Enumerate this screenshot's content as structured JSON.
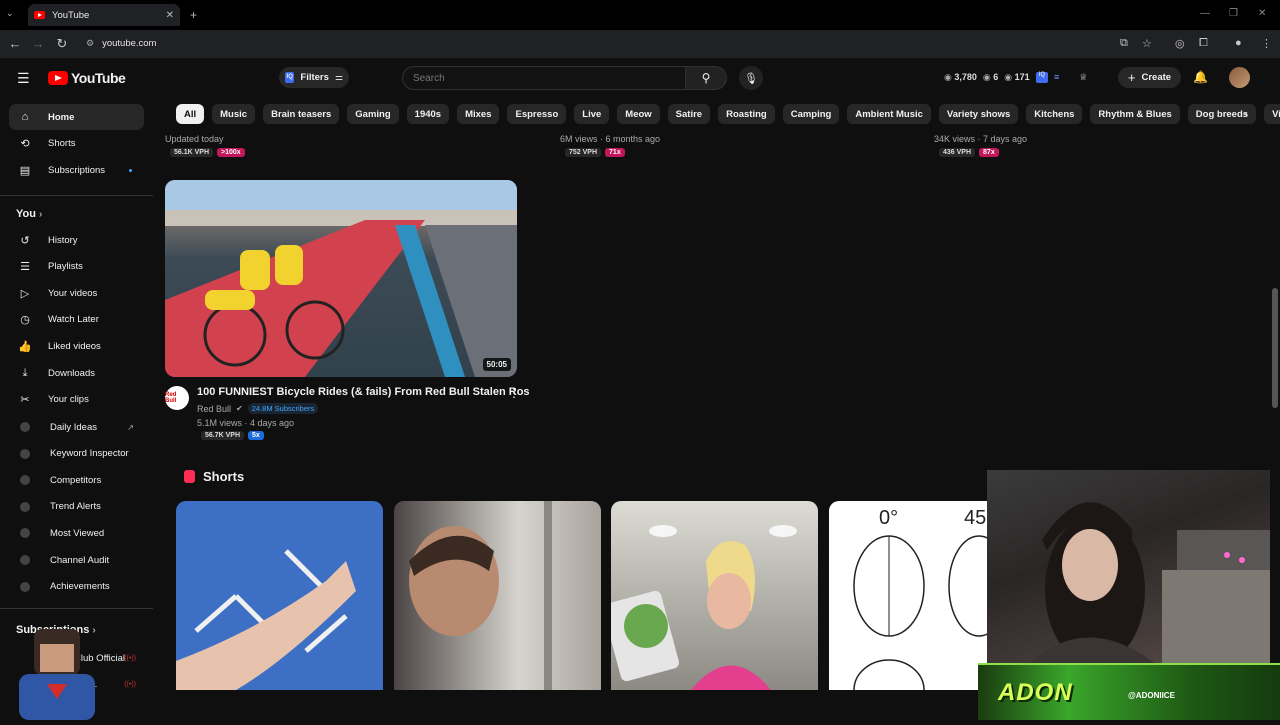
{
  "browser": {
    "tab_title": "YouTube",
    "tab_close": "✕",
    "new_tab": "+",
    "url": "youtube.com"
  },
  "masthead": {
    "logo_text": "YouTube",
    "filters_label": "Filters",
    "filters_badge": "IQ",
    "search_placeholder": "Search",
    "stats": [
      "3,780",
      "6",
      "171"
    ],
    "create_label": "Create"
  },
  "chips": [
    "All",
    "Music",
    "Brain teasers",
    "Gaming",
    "1940s",
    "Mixes",
    "Espresso",
    "Live",
    "Meow",
    "Satire",
    "Roasting",
    "Camping",
    "Ambient Music",
    "Variety shows",
    "Kitchens",
    "Rhythm & Blues",
    "Dog breeds",
    "Visua"
  ],
  "sidebar": {
    "main": [
      {
        "label": "Home",
        "icon": "home-icon",
        "glyph": "⌂"
      },
      {
        "label": "Shorts",
        "icon": "shorts-icon",
        "glyph": "⟲"
      },
      {
        "label": "Subscriptions",
        "icon": "subscriptions-icon",
        "glyph": "▤"
      }
    ],
    "you_header": "You",
    "you": [
      {
        "label": "History",
        "glyph": "↺"
      },
      {
        "label": "Playlists",
        "glyph": "☰"
      },
      {
        "label": "Your videos",
        "glyph": "▷"
      },
      {
        "label": "Watch Later",
        "glyph": "◷"
      },
      {
        "label": "Liked videos",
        "glyph": "👍"
      },
      {
        "label": "Downloads",
        "glyph": "⤓"
      },
      {
        "label": "Your clips",
        "glyph": "✂"
      }
    ],
    "extensions": [
      "Daily Ideas",
      "Keyword Inspector",
      "Competitors",
      "Trend Alerts",
      "Most Viewed",
      "Channel Audit",
      "Achievements"
    ],
    "subs_header": "Subscriptions",
    "subs": [
      "Club Official",
      "nel ..."
    ]
  },
  "top_row": [
    {
      "meta": "Updated today",
      "vph": "56.1K VPH",
      "mult": ">100x"
    },
    {
      "meta": "6M views · 6 months ago",
      "vph": "752 VPH",
      "mult": "71x"
    },
    {
      "meta": "34K views · 7 days ago",
      "vph": "436 VPH",
      "mult": "87x"
    }
  ],
  "video": {
    "title": "100 FUNNIEST Bicycle Rides (& fails) From Red Bull Stalen Ros",
    "duration": "50:05",
    "channel": "Red Bull",
    "subscribers": "24.8M Subscribers",
    "meta": "5.1M views · 4 days ago",
    "vph": "56.7K VPH",
    "mult": "5x",
    "avatar_text": "Red Bull"
  },
  "shorts": {
    "title": "Shorts",
    "degree_labels": [
      "0°",
      "45"
    ]
  },
  "overlay": {
    "streamer_name": "ADON",
    "handle": "@ADONIICE"
  }
}
